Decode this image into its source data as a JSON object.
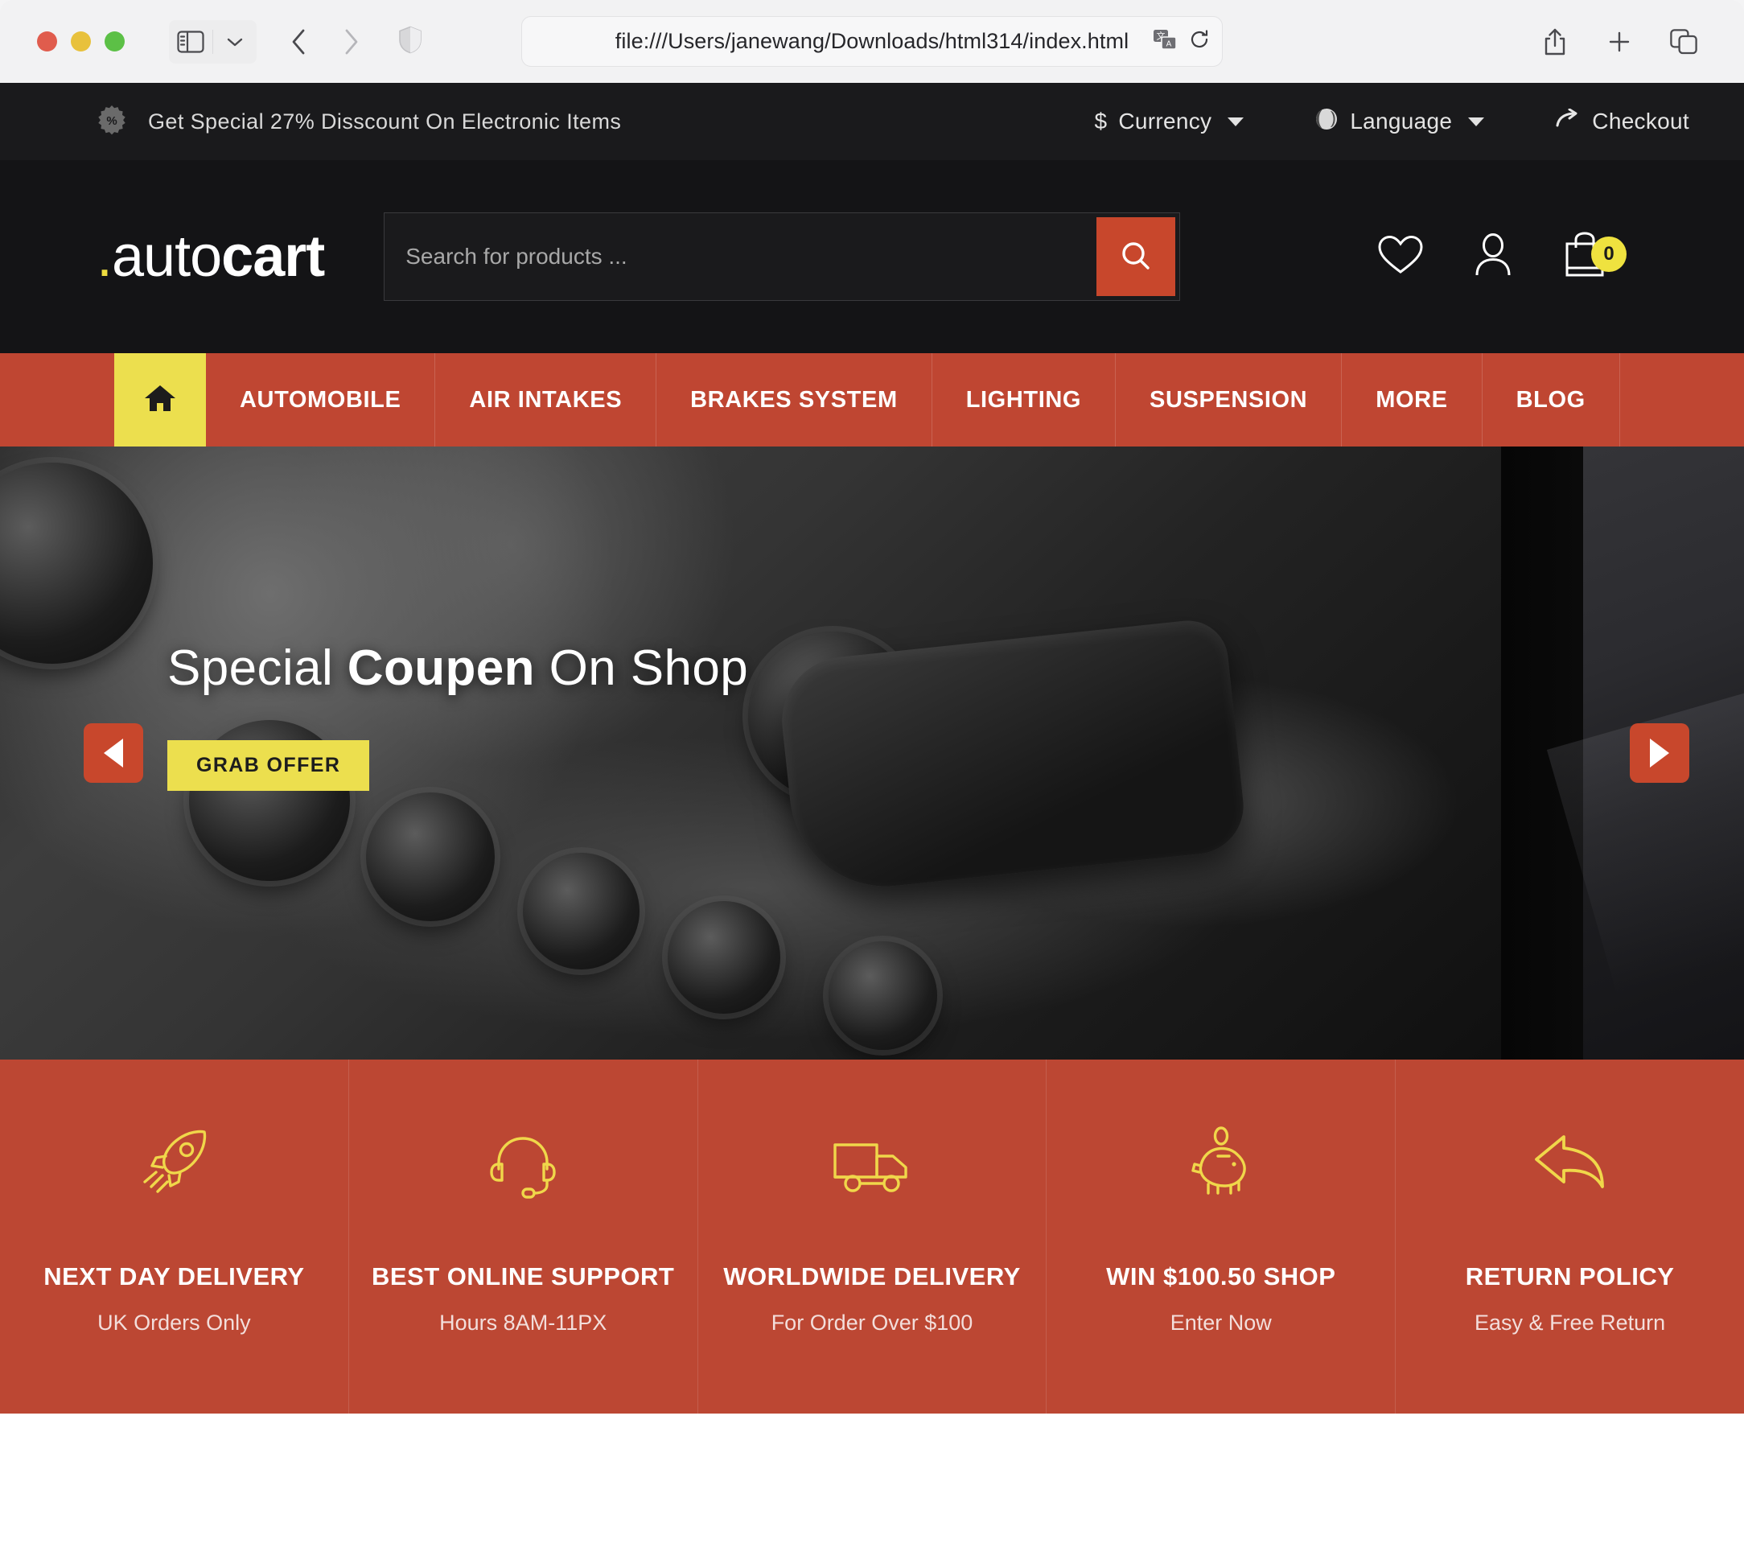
{
  "browser": {
    "url": "file:///Users/janewang/Downloads/html314/index.html",
    "traffic_lights": [
      "close",
      "minimize",
      "zoom"
    ],
    "icons": {
      "sidebar": "sidebar-icon",
      "sidebar_menu": "chevron-down-icon",
      "back": "back-arrow-icon",
      "forward": "forward-arrow-icon",
      "shield": "privacy-shield-icon",
      "translate": "translate-icon",
      "reload": "reload-icon",
      "share": "share-icon",
      "new_tab": "plus-icon",
      "tab_overview": "tab-overview-icon"
    }
  },
  "announcement": {
    "icon": "discount-badge-icon",
    "text": "Get Special 27% Disscount On Electronic Items",
    "currency_label": "Currency",
    "currency_symbol": "$",
    "language_label": "Language",
    "checkout_label": "Checkout"
  },
  "header": {
    "logo": {
      "dot": ".",
      "thin": "auto",
      "bold": "cart"
    },
    "search_placeholder": "Search for products ...",
    "search_value": "",
    "wishlist_icon": "heart-icon",
    "account_icon": "user-icon",
    "cart_icon": "shopping-bag-icon",
    "cart_count": "0"
  },
  "nav": {
    "home_icon": "home-icon",
    "items": [
      {
        "label": "AUTOMOBILE"
      },
      {
        "label": "AIR INTAKES"
      },
      {
        "label": "BRAKES SYSTEM"
      },
      {
        "label": "LIGHTING"
      },
      {
        "label": "SUSPENSION"
      },
      {
        "label": "MORE"
      },
      {
        "label": "BLOG"
      }
    ]
  },
  "hero": {
    "title_pre": "Special ",
    "title_bold": "Coupen",
    "title_post": " On Shop",
    "cta": "GRAB OFFER",
    "prev_icon": "chevron-left-icon",
    "next_icon": "chevron-right-icon"
  },
  "features": [
    {
      "icon": "rocket-icon",
      "title": "NEXT DAY DELIVERY",
      "sub": "UK Orders Only"
    },
    {
      "icon": "headset-icon",
      "title": "BEST ONLINE SUPPORT",
      "sub": "Hours 8AM-11PX"
    },
    {
      "icon": "truck-icon",
      "title": "WORLDWIDE DELIVERY",
      "sub": "For Order Over $100"
    },
    {
      "icon": "piggy-bank-icon",
      "title": "WIN $100.50 SHOP",
      "sub": "Enter Now"
    },
    {
      "icon": "return-arrow-icon",
      "title": "RETURN POLICY",
      "sub": "Easy & Free Return"
    }
  ],
  "colors": {
    "brand_red": "#bf4632",
    "accent_yellow": "#ecdf4e",
    "dark_bg": "#141416",
    "announce_bg": "#1a1a1c"
  }
}
